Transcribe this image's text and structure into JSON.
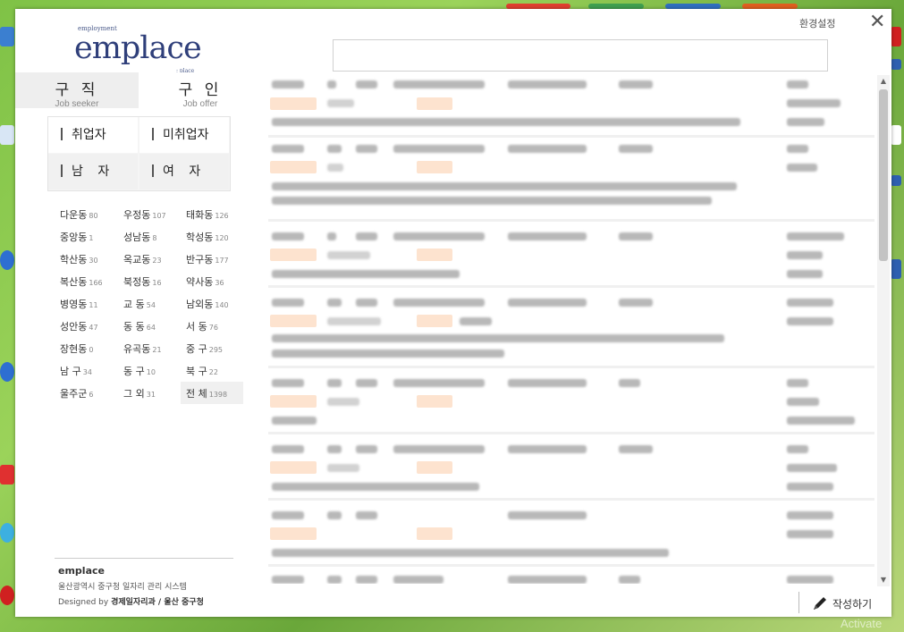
{
  "logo": {
    "small": "employment",
    "big": "emplace",
    "sub": "; place"
  },
  "tabs": [
    {
      "ko": "구 직",
      "en": "Job seeker"
    },
    {
      "ko": "구 인",
      "en": "Job offer"
    }
  ],
  "filters": [
    "취업자",
    "미취업자",
    "남 자",
    "여 자"
  ],
  "dongs": [
    {
      "name": "다운동",
      "count": "80"
    },
    {
      "name": "우정동",
      "count": "107"
    },
    {
      "name": "태화동",
      "count": "126"
    },
    {
      "name": "중앙동",
      "count": "1"
    },
    {
      "name": "성남동",
      "count": "8"
    },
    {
      "name": "학성동",
      "count": "120"
    },
    {
      "name": "학산동",
      "count": "30"
    },
    {
      "name": "옥교동",
      "count": "23"
    },
    {
      "name": "반구동",
      "count": "177"
    },
    {
      "name": "복산동",
      "count": "166"
    },
    {
      "name": "북정동",
      "count": "16"
    },
    {
      "name": "약사동",
      "count": "36"
    },
    {
      "name": "병영동",
      "count": "11"
    },
    {
      "name": "교 동",
      "count": "54"
    },
    {
      "name": "남외동",
      "count": "140"
    },
    {
      "name": "성안동",
      "count": "47"
    },
    {
      "name": "동 동",
      "count": "64"
    },
    {
      "name": "서 동",
      "count": "76"
    },
    {
      "name": "장현동",
      "count": "0"
    },
    {
      "name": "유곡동",
      "count": "21"
    },
    {
      "name": "중 구",
      "count": "295"
    },
    {
      "name": "남 구",
      "count": "34"
    },
    {
      "name": "동 구",
      "count": "10"
    },
    {
      "name": "북 구",
      "count": "22"
    },
    {
      "name": "울주군",
      "count": "6"
    },
    {
      "name": "그 외",
      "count": "31"
    },
    {
      "name": "전 체",
      "count": "1398"
    }
  ],
  "footer": {
    "name": "emplace",
    "desc": "울산광역시 중구청 일자리 관리 시스템",
    "credit_prefix": "Designed by ",
    "credit_dept": "경제일자리과 / 울산 중구청"
  },
  "header": {
    "settings": "환경설정",
    "close": "✕",
    "search_value": ""
  },
  "write_label": "작성하기",
  "os": {
    "activate": "Activate"
  }
}
